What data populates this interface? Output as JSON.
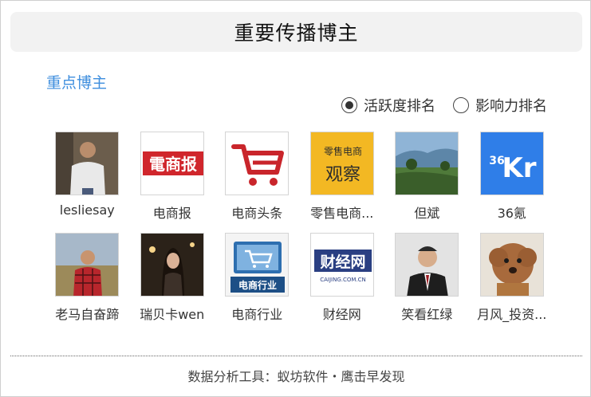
{
  "header": {
    "title": "重要传播博主"
  },
  "section": {
    "title": "重点博主"
  },
  "ranking": {
    "options": [
      {
        "label": "活跃度排名",
        "selected": true
      },
      {
        "label": "影响力排名",
        "selected": false
      }
    ]
  },
  "bloggers": [
    {
      "name": "lesliesay",
      "avatar_icon": "person-photo-icon"
    },
    {
      "name": "电商报",
      "avatar_icon": "dianshangbao-logo-icon",
      "logo_text": "電商报"
    },
    {
      "name": "电商头条",
      "avatar_icon": "shopping-cart-logo-icon"
    },
    {
      "name": "零售电商...",
      "avatar_icon": "retail-ecommerce-logo-icon",
      "logo_text_top": "零售电商",
      "logo_text_bottom": "观察"
    },
    {
      "name": "但斌",
      "avatar_icon": "landscape-photo-icon"
    },
    {
      "name": "36氪",
      "avatar_icon": "36kr-logo-icon",
      "logo_text_small": "36",
      "logo_text_big": "Kr"
    },
    {
      "name": "老马自奋蹄",
      "avatar_icon": "person-photo-icon"
    },
    {
      "name": "瑞贝卡wen",
      "avatar_icon": "person-photo-icon"
    },
    {
      "name": "电商行业",
      "avatar_icon": "ecommerce-industry-logo-icon",
      "logo_text": "电商行业"
    },
    {
      "name": "财经网",
      "avatar_icon": "caijing-logo-icon",
      "logo_text": "财经网",
      "logo_sub": "CAIJING.COM.CN"
    },
    {
      "name": "笑看红绿",
      "avatar_icon": "person-photo-icon"
    },
    {
      "name": "月风_投资...",
      "avatar_icon": "dog-photo-icon"
    }
  ],
  "footer": {
    "text": "数据分析工具：蚁坊软件・鹰击早发现"
  },
  "colors": {
    "accent": "#3e8ede",
    "title_bg": "#f2f2f2",
    "logo_red": "#d0262c",
    "logo_yellow": "#f3b823",
    "logo_blue": "#2f7ee8"
  }
}
